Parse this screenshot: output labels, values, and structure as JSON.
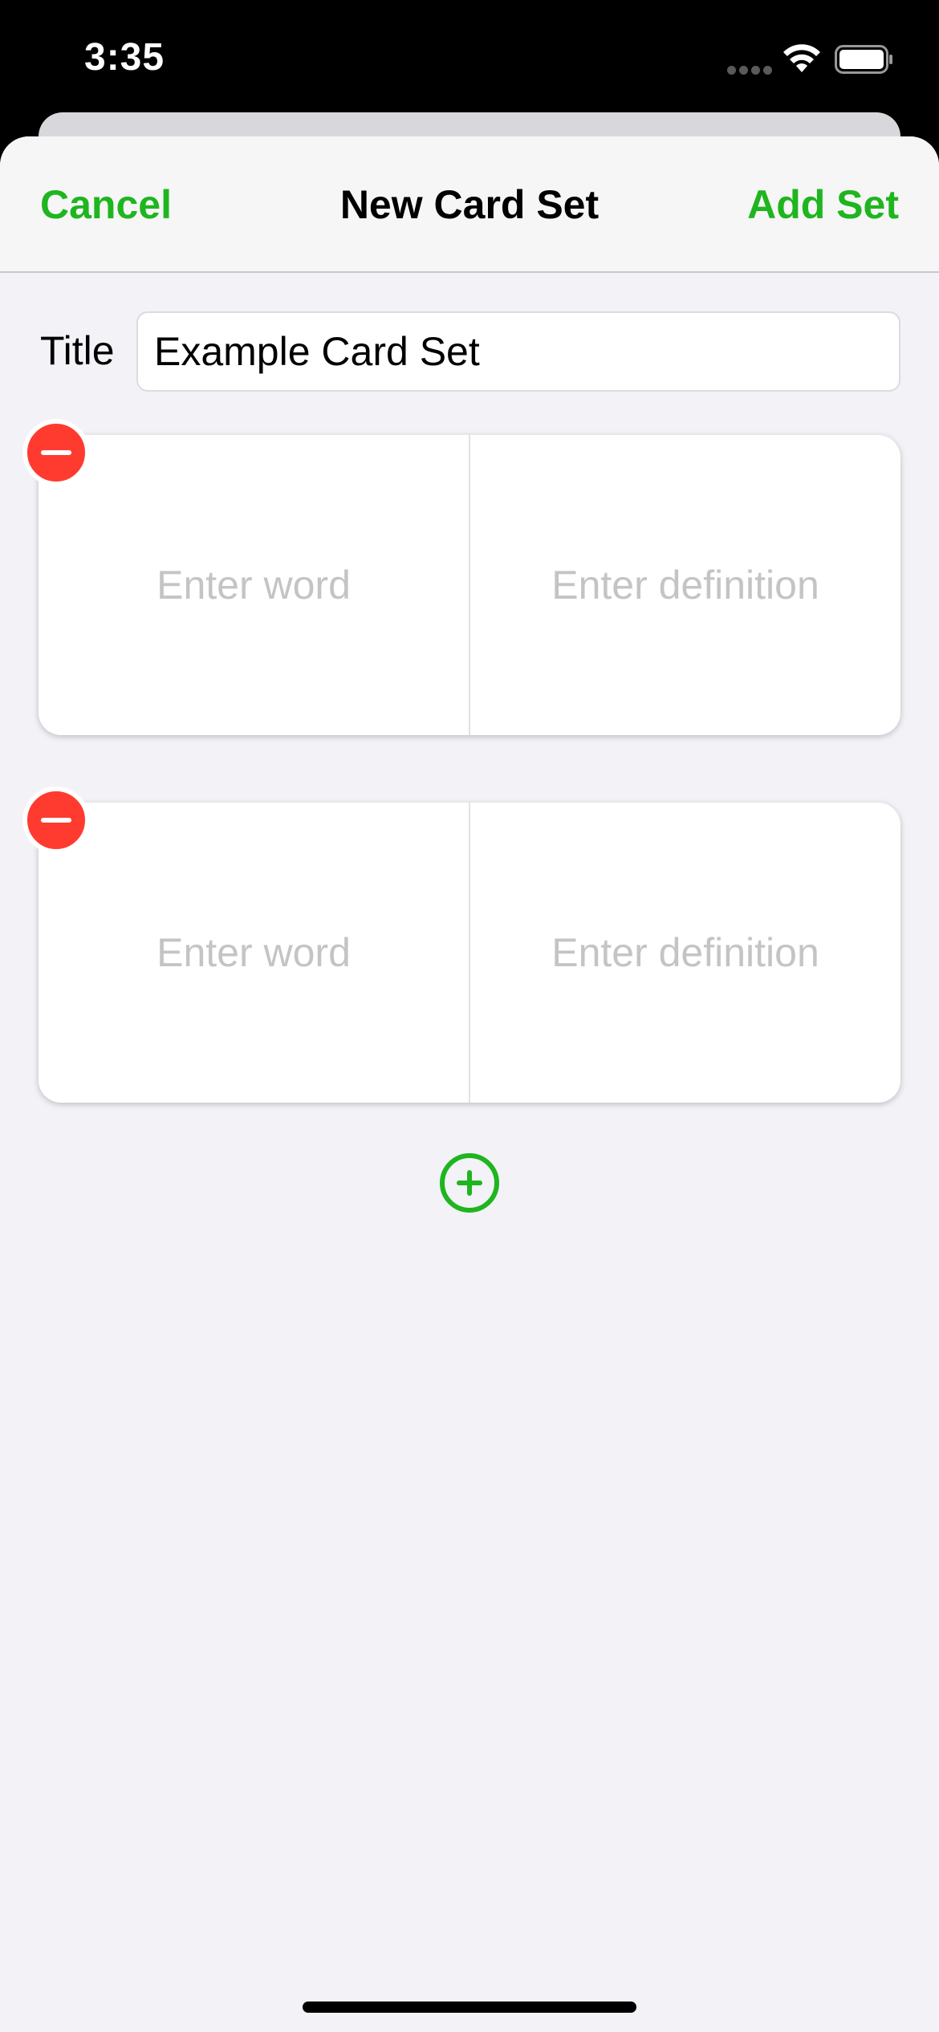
{
  "status_bar": {
    "time": "3:35",
    "icons": [
      "signal-dots-icon",
      "wifi-icon",
      "battery-icon"
    ]
  },
  "nav": {
    "cancel_label": "Cancel",
    "title": "New Card Set",
    "add_label": "Add Set"
  },
  "form": {
    "title_label": "Title",
    "title_value": "Example Card Set"
  },
  "cards": [
    {
      "word_placeholder": "Enter word",
      "definition_placeholder": "Enter definition",
      "word_value": "",
      "definition_value": ""
    },
    {
      "word_placeholder": "Enter word",
      "definition_placeholder": "Enter definition",
      "word_value": "",
      "definition_value": ""
    }
  ],
  "colors": {
    "accent": "#1fb51f",
    "destructive": "#ff3b30",
    "background": "#f2f2f7",
    "placeholder": "#c4c4c6"
  }
}
